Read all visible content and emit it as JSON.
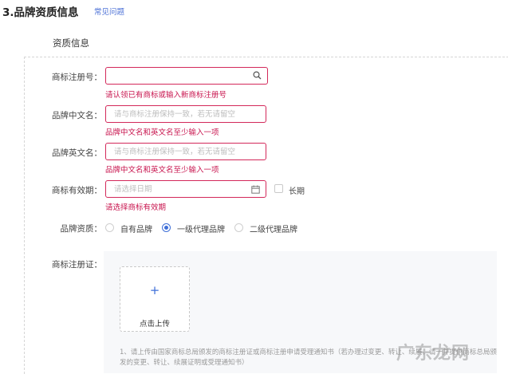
{
  "header": {
    "section_title": "3.品牌资质信息",
    "faq_link": "常见问题"
  },
  "form": {
    "subtitle": "资质信息",
    "trademark_no": {
      "label": "商标注册号：",
      "value": "",
      "icon": "search-icon",
      "error": "请认领已有商标或输入新商标注册号"
    },
    "brand_cn": {
      "label": "品牌中文名：",
      "placeholder": "请与商标注册保持一致，若无请留空",
      "error": "品牌中文名和英文名至少输入一项"
    },
    "brand_en": {
      "label": "品牌英文名：",
      "placeholder": "请与商标注册保持一致，若无请留空",
      "error": "品牌中文名和英文名至少输入一项"
    },
    "validity": {
      "label": "商标有效期：",
      "placeholder": "请选择日期",
      "icon": "calendar-icon",
      "long_term_label": "长期",
      "long_term_checked": false,
      "error": "请选择商标有效期"
    },
    "qualification": {
      "label": "品牌资质：",
      "options": [
        "自有品牌",
        "一级代理品牌",
        "二级代理品牌"
      ],
      "selected": "一级代理品牌"
    },
    "certificate": {
      "label": "商标注册证：",
      "upload_icon": "plus-icon",
      "upload_plus": "+",
      "upload_text": "点击上传",
      "note": "1、请上传由国家商标总局颁发的商标注册证或商标注册申请受理通知书（若办理过变更、转让、续展，请一并提供商标总局颁发的变更、转让、续展证明或受理通知书）"
    }
  },
  "colors": {
    "error": "#c8144e",
    "accent": "#3f6fd8",
    "link": "#4a6fd6"
  },
  "watermark": "广东龙网"
}
